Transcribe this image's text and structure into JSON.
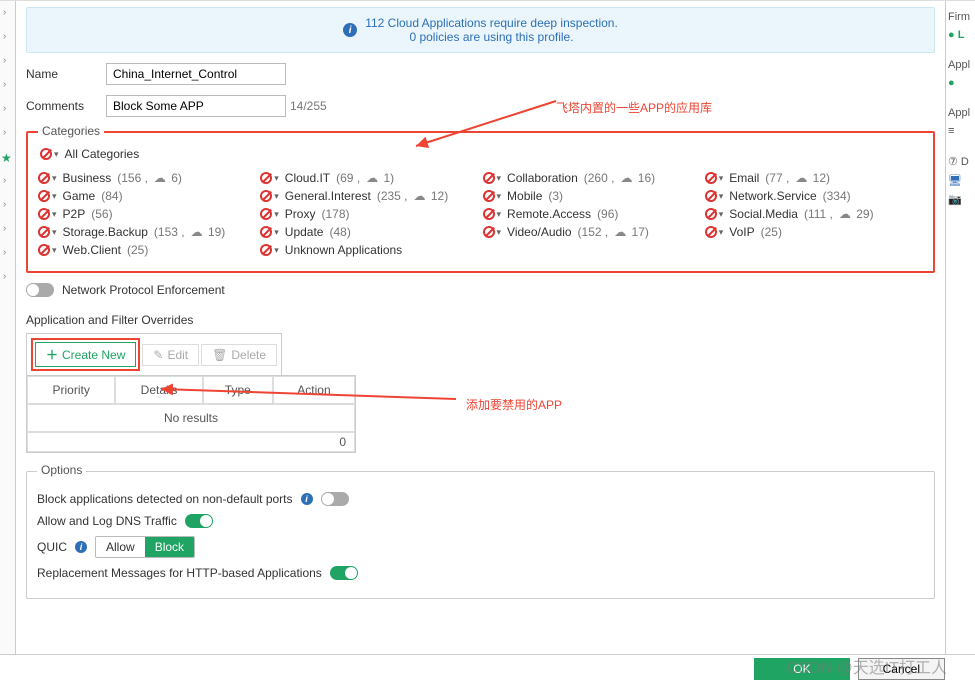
{
  "banner": {
    "line1": "112 Cloud Applications require deep inspection.",
    "line2": "0 policies are using this profile."
  },
  "form": {
    "name_label": "Name",
    "name_value": "China_Internet_Control",
    "comments_label": "Comments",
    "comments_value": "Block Some APP",
    "comments_counter": "14/255"
  },
  "annotations": {
    "top": "飞塔内置的一些APP的应用库",
    "mid": "添加要禁用的APP"
  },
  "categories": {
    "legend": "Categories",
    "all_label": "All Categories",
    "items": [
      {
        "name": "Business",
        "count": "(156 ,",
        "cloud": " 6)"
      },
      {
        "name": "Cloud.IT",
        "count": "(69 ,",
        "cloud": " 1)"
      },
      {
        "name": "Collaboration",
        "count": "(260 ,",
        "cloud": " 16)"
      },
      {
        "name": "Email",
        "count": "(77 ,",
        "cloud": " 12)"
      },
      {
        "name": "Game",
        "count": "(84)",
        "cloud": ""
      },
      {
        "name": "General.Interest",
        "count": "(235 ,",
        "cloud": " 12)"
      },
      {
        "name": "Mobile",
        "count": "(3)",
        "cloud": ""
      },
      {
        "name": "Network.Service",
        "count": "(334)",
        "cloud": ""
      },
      {
        "name": "P2P",
        "count": "(56)",
        "cloud": ""
      },
      {
        "name": "Proxy",
        "count": "(178)",
        "cloud": ""
      },
      {
        "name": "Remote.Access",
        "count": "(96)",
        "cloud": ""
      },
      {
        "name": "Social.Media",
        "count": "(111 ,",
        "cloud": " 29)"
      },
      {
        "name": "Storage.Backup",
        "count": "(153 ,",
        "cloud": " 19)"
      },
      {
        "name": "Update",
        "count": "(48)",
        "cloud": ""
      },
      {
        "name": "Video/Audio",
        "count": "(152 ,",
        "cloud": " 17)"
      },
      {
        "name": "VoIP",
        "count": "(25)",
        "cloud": ""
      },
      {
        "name": "Web.Client",
        "count": "(25)",
        "cloud": ""
      },
      {
        "name": "Unknown Applications",
        "count": "",
        "cloud": ""
      }
    ]
  },
  "npe_label": "Network Protocol Enforcement",
  "overrides": {
    "heading": "Application and Filter Overrides",
    "create": "Create New",
    "edit": "Edit",
    "delete": "Delete",
    "cols": {
      "priority": "Priority",
      "details": "Details",
      "type": "Type",
      "action": "Action"
    },
    "no_results": "No results",
    "count": "0"
  },
  "options": {
    "legend": "Options",
    "block_nondefault": "Block applications detected on non-default ports",
    "allow_dns": "Allow and Log DNS Traffic",
    "quic": "QUIC",
    "quic_allow": "Allow",
    "quic_block": "Block",
    "replacement": "Replacement Messages for HTTP-based Applications"
  },
  "footer": {
    "ok": "OK",
    "cancel": "Cancel"
  },
  "right": {
    "firm": "Firm",
    "appl1": "Appl",
    "appl2": "Appl",
    "d": "D"
  },
  "watermark": "CSDN @天选IT打工人"
}
